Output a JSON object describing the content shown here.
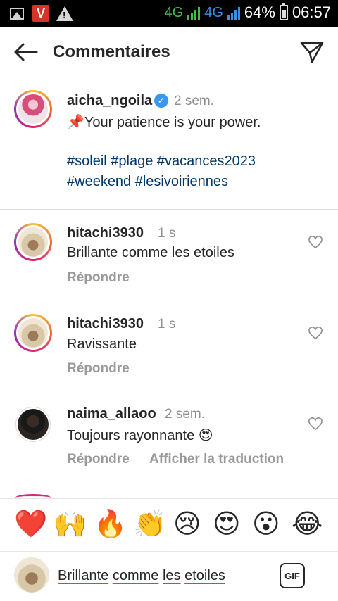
{
  "status_bar": {
    "network_label": "4G",
    "network_label2": "4G",
    "battery": "64%",
    "time": "06:57"
  },
  "header": {
    "title": "Commentaires"
  },
  "caption": {
    "username": "aicha_ngoila",
    "time": "2 sem.",
    "text": "📌Your patience is your power.",
    "hashtags_line1": "#soleil #plage #vacances2023",
    "hashtags_line2": "#weekend #lesivoiriennes"
  },
  "comments": [
    {
      "username": "hitachi3930",
      "time": "1 s",
      "text": "Brillante comme les etoiles",
      "reply": "Répondre"
    },
    {
      "username": "hitachi3930",
      "time": "1 s",
      "text": "Ravissante",
      "reply": "Répondre"
    },
    {
      "username": "naima_allaoo",
      "time": "2 sem.",
      "text": "Toujours rayonnante 😍",
      "reply": "Répondre",
      "translate": "Afficher la traduction"
    }
  ],
  "reactions": [
    "❤️",
    "🙌",
    "🔥",
    "👏",
    "😢",
    "😍",
    "😮",
    "😂"
  ],
  "composer": {
    "w1": "Brillante",
    "w2": "comme",
    "w3": "les",
    "w4": "etoiles",
    "gif_label": "GIF"
  }
}
